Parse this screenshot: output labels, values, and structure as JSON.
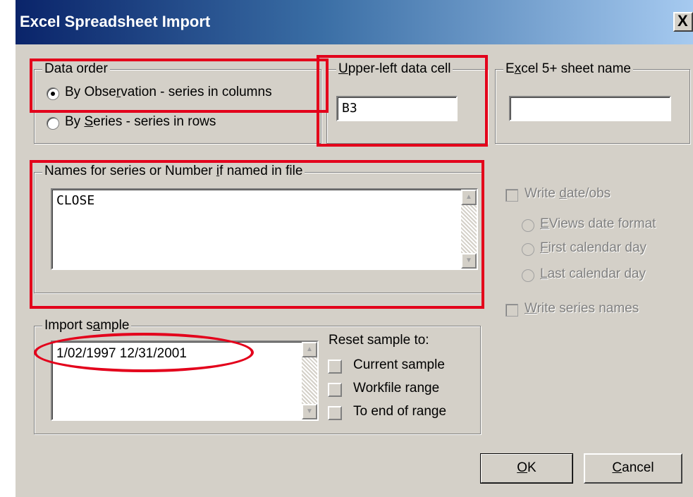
{
  "window": {
    "title": "Excel Spreadsheet Import",
    "close_glyph": "X"
  },
  "data_order": {
    "legend": "Data order",
    "options": [
      {
        "pre": "By Obse",
        "u": "r",
        "post": "vation - series in columns",
        "selected": true
      },
      {
        "pre": "By ",
        "u": "S",
        "post": "eries - series in rows",
        "selected": false
      }
    ]
  },
  "upper_left": {
    "legend_u": "U",
    "legend_rest": "pper-left data cell",
    "value": "B3"
  },
  "sheet_name": {
    "legend_pre": "E",
    "legend_u": "x",
    "legend_rest": "cel 5+ sheet name",
    "value": ""
  },
  "names": {
    "legend_pre": "Names for series or Number ",
    "legend_u": "i",
    "legend_rest": "f named in file",
    "value": "CLOSE"
  },
  "write_date": {
    "checkbox": {
      "pre": "Write ",
      "u": "d",
      "post": "ate/obs"
    },
    "options": [
      {
        "u": "E",
        "post": "Views date format"
      },
      {
        "u": "F",
        "post": "irst calendar day"
      },
      {
        "u": "L",
        "post": "ast calendar day"
      }
    ]
  },
  "write_names": {
    "u": "W",
    "post": "rite series names"
  },
  "import_sample": {
    "legend_pre": "Import s",
    "legend_u": "a",
    "legend_rest": "mple",
    "value": "1/02/1997 12/31/2001",
    "reset_label": "Reset sample to:",
    "reset_options": [
      "Current sample",
      "Workfile range",
      "To end of range"
    ]
  },
  "buttons": {
    "ok_u": "O",
    "ok_rest": "K",
    "cancel_u": "C",
    "cancel_rest": "ancel"
  },
  "colors": {
    "dialog": "#d4d0c8",
    "title_start": "#0a246a",
    "highlight": "#e3001b"
  }
}
